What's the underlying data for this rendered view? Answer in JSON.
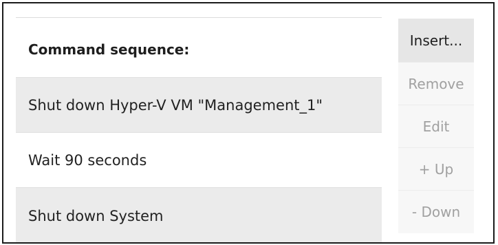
{
  "table": {
    "header": "Command sequence:",
    "rows": [
      "Shut down Hyper-V VM \"Management_1\"",
      "Wait 90 seconds",
      "Shut down System"
    ]
  },
  "buttons": {
    "insert": "Insert...",
    "remove": "Remove",
    "edit": "Edit",
    "up": "+ Up",
    "down": "- Down"
  }
}
